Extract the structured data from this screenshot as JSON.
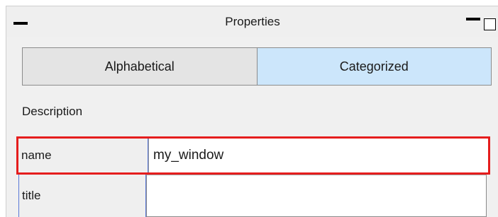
{
  "window": {
    "title": "Properties"
  },
  "tabs": [
    {
      "label": "Alphabetical",
      "selected": false
    },
    {
      "label": "Categorized",
      "selected": true
    }
  ],
  "section": {
    "label": "Description"
  },
  "properties": [
    {
      "name": "name",
      "value": "my_window",
      "highlighted": true
    },
    {
      "name": "title",
      "value": ""
    }
  ],
  "colors": {
    "selected_tab": "#cce6fb",
    "highlight_border": "#e51d1d",
    "cell_divider": "#5a79d8"
  }
}
